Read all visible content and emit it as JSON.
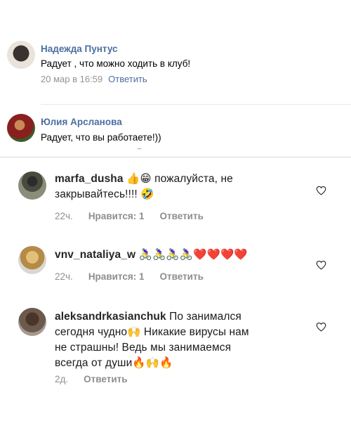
{
  "vk": {
    "comments": [
      {
        "author": "Надежда Пунтус",
        "text": "Радует , что можно ходить в клуб!",
        "date": "20 мар в 16:59",
        "reply": "Ответить"
      },
      {
        "author": "Юлия Арсланова",
        "text": "Радует, что вы работаете!))"
      }
    ]
  },
  "instagram": {
    "comments": [
      {
        "username": "marfa_dusha",
        "text_line1": "👍😁 пожалуйста, не",
        "text_line2": "закрывайтесь!!!! 🤣",
        "time": "22ч.",
        "likes": "Нравится: 1",
        "reply": "Ответить"
      },
      {
        "username": "vnv_nataliya_w",
        "text_line1": "🚴‍♀️🚴‍♀️🚴‍♀️🚴‍♀️❤️❤️❤️❤️",
        "time": "22ч.",
        "likes": "Нравится: 1",
        "reply": "Ответить"
      },
      {
        "username": "aleksandrkasianchuk",
        "text_line1": "По занимался",
        "text_line2": "сегодня чудно🙌 Никакие вирусы нам",
        "text_line3": "не страшны! Ведь мы занимаемся",
        "text_line4": "всегда от души🔥🙌🔥",
        "time": "2д.",
        "reply": "Ответить"
      }
    ]
  },
  "icons": {
    "heart": "heart-outline-icon"
  },
  "colors": {
    "vk_link": "#4a6fa0",
    "ig_meta": "#8e8e8e"
  }
}
